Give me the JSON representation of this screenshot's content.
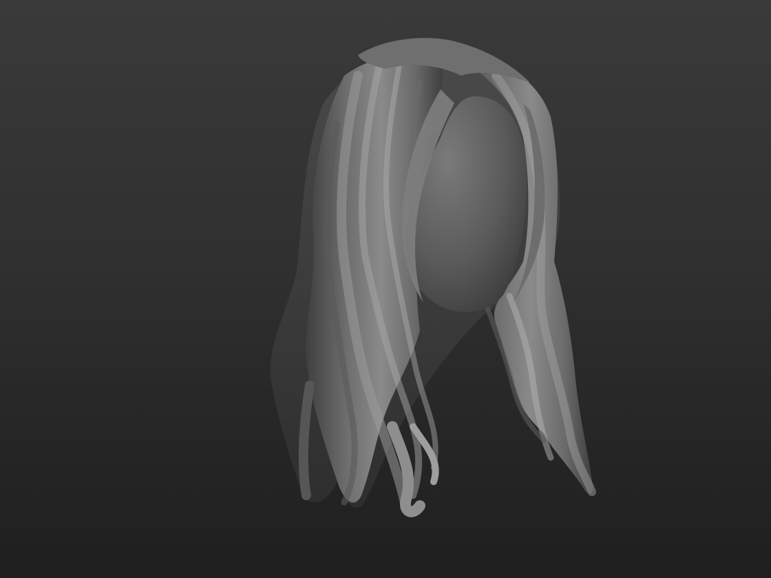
{
  "viewport": {
    "background_top": "#3a3a3a",
    "background_bottom": "#1f1f1f"
  },
  "model": {
    "icon": "hair-sculpt-mesh",
    "material_color": "#8a8a8a"
  }
}
